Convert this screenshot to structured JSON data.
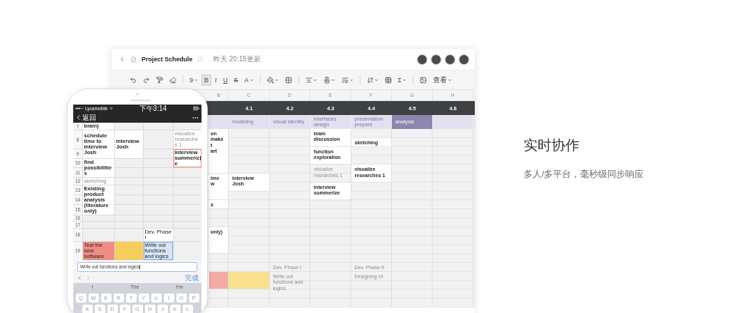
{
  "sheet_window": {
    "header": {
      "title": "Project Schedule",
      "updated": "昨天 20:15更新",
      "avatars": [
        {
          "kind": "photo"
        },
        {
          "kind": "photo"
        },
        {
          "kind": "photo"
        },
        {
          "kind": "photo"
        }
      ]
    },
    "toolbar": [
      {
        "kind": "undo"
      },
      {
        "kind": "redo"
      },
      {
        "kind": "painter"
      },
      {
        "kind": "eraser"
      },
      {
        "kind": "divider"
      },
      {
        "kind": "size",
        "text": "9",
        "dropdown": true
      },
      {
        "kind": "bold",
        "text": "B",
        "selected": true
      },
      {
        "kind": "italic",
        "text": "I",
        "selected": false
      },
      {
        "kind": "underline",
        "text": "U",
        "selected": false
      },
      {
        "kind": "strike",
        "text": "S",
        "selected": false
      },
      {
        "kind": "color",
        "text": "A",
        "dropdown": true
      },
      {
        "kind": "divider"
      },
      {
        "kind": "fill",
        "dropdown": true
      },
      {
        "kind": "merge"
      },
      {
        "kind": "divider"
      },
      {
        "kind": "align",
        "dropdown": true
      },
      {
        "kind": "valign",
        "dropdown": true
      },
      {
        "kind": "wrap",
        "dropdown": true
      },
      {
        "kind": "divider"
      },
      {
        "kind": "sort",
        "dropdown": true
      },
      {
        "kind": "table"
      },
      {
        "kind": "sum",
        "text": "Σ",
        "dropdown": true
      },
      {
        "kind": "divider"
      },
      {
        "kind": "image"
      },
      {
        "kind": "menu",
        "text": "查看",
        "dropdown": true
      }
    ],
    "columns": [
      "B",
      "C",
      "D",
      "E",
      "F",
      "G",
      "H"
    ],
    "weeks": [
      "4.1",
      "4.2",
      "4.3",
      "4.4",
      "4.5",
      "4.6"
    ],
    "phases": [
      {
        "text": "modeling",
        "selected": false
      },
      {
        "text": "visual identity",
        "selected": false
      },
      {
        "text": "interfaces design",
        "selected": false
      },
      {
        "text": "presentation prepare",
        "selected": false
      },
      {
        "text": "analysis",
        "selected": true
      },
      {
        "selected": false
      }
    ],
    "rows": [
      [
        {
          "kind": "bold",
          "text": "on\nmake\nt\nart"
        },
        {
          "kind": "empty"
        },
        {
          "kind": "empty"
        },
        {
          "kind": "bold",
          "text": "team discussion"
        },
        {
          "kind": "empty"
        },
        {
          "kind": "empty"
        },
        {
          "kind": "empty"
        }
      ],
      [
        {
          "kind": "merged"
        },
        {
          "kind": "empty"
        },
        {
          "kind": "empty"
        },
        {
          "kind": "merged"
        },
        {
          "kind": "bold",
          "text": "sketching"
        },
        {
          "kind": "empty"
        },
        {
          "kind": "empty"
        }
      ],
      [
        {
          "kind": "merged"
        },
        {
          "kind": "empty"
        },
        {
          "kind": "empty"
        },
        {
          "kind": "bold",
          "text": "function exploration"
        },
        {
          "kind": "empty"
        },
        {
          "kind": "empty"
        },
        {
          "kind": "empty"
        }
      ],
      [
        {
          "kind": "merged"
        },
        {
          "kind": "empty"
        },
        {
          "kind": "empty"
        },
        {
          "kind": "merged"
        },
        {
          "kind": "empty"
        },
        {
          "kind": "empty"
        },
        {
          "kind": "empty"
        }
      ],
      [
        {
          "kind": "merged"
        },
        {
          "kind": "empty"
        },
        {
          "kind": "empty"
        },
        {
          "kind": "faded",
          "text": "visualize researches 1"
        },
        {
          "kind": "bold",
          "text": "visualize researches 1"
        },
        {
          "kind": "empty"
        },
        {
          "kind": "empty"
        }
      ],
      [
        {
          "kind": "bold",
          "text": "ime\nw"
        },
        {
          "kind": "bold",
          "text": "interview Josh"
        },
        {
          "kind": "empty"
        },
        {
          "kind": "merged"
        },
        {
          "kind": "merged"
        },
        {
          "kind": "empty"
        },
        {
          "kind": "empty"
        }
      ],
      [
        {
          "kind": "merged"
        },
        {
          "kind": "merged"
        },
        {
          "kind": "empty"
        },
        {
          "kind": "bold",
          "text": "interview summerize"
        },
        {
          "kind": "empty"
        },
        {
          "kind": "empty"
        },
        {
          "kind": "empty"
        }
      ],
      [
        {
          "kind": "merged"
        },
        {
          "kind": "empty"
        },
        {
          "kind": "empty"
        },
        {
          "kind": "merged"
        },
        {
          "kind": "empty"
        },
        {
          "kind": "empty"
        },
        {
          "kind": "empty"
        }
      ],
      [
        {
          "kind": "bold",
          "text": "s"
        },
        {
          "kind": "empty"
        },
        {
          "kind": "empty"
        },
        {
          "kind": "empty"
        },
        {
          "kind": "empty"
        },
        {
          "kind": "empty"
        },
        {
          "kind": "empty"
        }
      ],
      [
        {
          "kind": "empty"
        },
        {
          "kind": "empty"
        },
        {
          "kind": "empty"
        },
        {
          "kind": "empty"
        },
        {
          "kind": "empty"
        },
        {
          "kind": "empty"
        },
        {
          "kind": "empty"
        }
      ],
      [
        {
          "kind": "empty"
        },
        {
          "kind": "empty"
        },
        {
          "kind": "empty"
        },
        {
          "kind": "empty"
        },
        {
          "kind": "empty"
        },
        {
          "kind": "empty"
        },
        {
          "kind": "empty"
        }
      ],
      [
        {
          "kind": "bold",
          "text": "only)"
        },
        {
          "kind": "empty"
        },
        {
          "kind": "empty"
        },
        {
          "kind": "empty"
        },
        {
          "kind": "empty"
        },
        {
          "kind": "empty"
        },
        {
          "kind": "empty"
        }
      ],
      [
        {
          "kind": "merged"
        },
        {
          "kind": "empty"
        },
        {
          "kind": "empty"
        },
        {
          "kind": "empty"
        },
        {
          "kind": "empty"
        },
        {
          "kind": "empty"
        },
        {
          "kind": "empty"
        }
      ],
      [
        {
          "kind": "merged"
        },
        {
          "kind": "empty"
        },
        {
          "kind": "empty"
        },
        {
          "kind": "empty"
        },
        {
          "kind": "empty"
        },
        {
          "kind": "empty"
        },
        {
          "kind": "empty"
        }
      ],
      [
        {
          "kind": "empty"
        },
        {
          "kind": "empty"
        },
        {
          "kind": "empty"
        },
        {
          "kind": "empty"
        },
        {
          "kind": "empty"
        },
        {
          "kind": "empty"
        },
        {
          "kind": "empty"
        }
      ],
      [
        {
          "kind": "empty"
        },
        {
          "kind": "empty"
        },
        {
          "kind": "plain",
          "text": "Dev. Phase I"
        },
        {
          "kind": "empty"
        },
        {
          "kind": "plain",
          "text": "Dev. Phase II"
        },
        {
          "kind": "empty"
        },
        {
          "kind": "empty"
        }
      ],
      [
        {
          "kind": "filled",
          "color": "#f4aaa5"
        },
        {
          "kind": "filled",
          "color": "#f9e08e"
        },
        {
          "kind": "plain",
          "text": "Write out functions and logics"
        },
        {
          "kind": "empty"
        },
        {
          "kind": "plain",
          "text": "Designing UI"
        },
        {
          "kind": "empty"
        },
        {
          "kind": "empty"
        }
      ],
      [
        {
          "kind": "merged"
        },
        {
          "kind": "merged"
        },
        {
          "kind": "merged"
        },
        {
          "kind": "empty"
        },
        {
          "kind": "merged"
        },
        {
          "kind": "empty"
        },
        {
          "kind": "empty"
        }
      ],
      [
        {
          "kind": "empty"
        },
        {
          "kind": "empty"
        },
        {
          "kind": "merged"
        },
        {
          "kind": "empty"
        },
        {
          "kind": "empty"
        },
        {
          "kind": "empty"
        },
        {
          "kind": "empty"
        }
      ],
      [
        {
          "kind": "empty"
        },
        {
          "kind": "empty"
        },
        {
          "kind": "empty"
        },
        {
          "kind": "empty"
        },
        {
          "kind": "empty"
        },
        {
          "kind": "empty"
        },
        {
          "kind": "empty"
        }
      ]
    ]
  },
  "phone": {
    "status": {
      "carrier": "Lycamobile",
      "time": "下午3:14"
    },
    "nav": {
      "back": "返回"
    },
    "rows": [
      {
        "number": "7",
        "cells": [
          {
            "kind": "bold",
            "text": "brain)"
          },
          {
            "kind": "empty"
          },
          {
            "kind": "empty"
          },
          {
            "kind": "empty"
          }
        ]
      },
      {
        "number": "8",
        "cells": [
          {
            "kind": "bold",
            "text": "schedule time to interview Josh"
          },
          {
            "kind": "bold",
            "text": "interview Josh"
          },
          {
            "kind": "empty"
          },
          {
            "kind": "faded",
            "text": "visualize researches 1"
          }
        ]
      },
      {
        "number": "9",
        "cells": [
          {
            "kind": "merged"
          },
          {
            "kind": "merged"
          },
          {
            "kind": "empty"
          },
          {
            "kind": "outlined",
            "text": "interview summerize"
          }
        ]
      },
      {
        "number": "10",
        "cells": [
          {
            "kind": "bold",
            "text": "find possibilities"
          },
          {
            "kind": "empty"
          },
          {
            "kind": "empty"
          },
          {
            "kind": "merged"
          }
        ]
      },
      {
        "number": "11",
        "cells": [
          {
            "kind": "merged"
          },
          {
            "kind": "empty"
          },
          {
            "kind": "empty"
          },
          {
            "kind": "empty"
          }
        ]
      },
      {
        "number": "12",
        "cells": [
          {
            "kind": "faded",
            "text": "sketching"
          },
          {
            "kind": "empty"
          },
          {
            "kind": "empty"
          },
          {
            "kind": "empty"
          }
        ]
      },
      {
        "number": "13",
        "cells": [
          {
            "kind": "bold",
            "text": "Existing product analysis (literature only)"
          },
          {
            "kind": "empty"
          },
          {
            "kind": "empty"
          },
          {
            "kind": "empty"
          }
        ]
      },
      {
        "number": "14",
        "cells": [
          {
            "kind": "merged"
          },
          {
            "kind": "empty"
          },
          {
            "kind": "empty"
          },
          {
            "kind": "empty"
          }
        ]
      },
      {
        "number": "15",
        "cells": [
          {
            "kind": "merged"
          },
          {
            "kind": "empty"
          },
          {
            "kind": "empty"
          },
          {
            "kind": "empty"
          }
        ]
      },
      {
        "number": "16",
        "cells": [
          {
            "kind": "empty"
          },
          {
            "kind": "empty"
          },
          {
            "kind": "empty"
          },
          {
            "kind": "empty"
          }
        ]
      },
      {
        "number": "17",
        "cells": [
          {
            "kind": "empty"
          },
          {
            "kind": "empty"
          },
          {
            "kind": "empty"
          },
          {
            "kind": "empty"
          }
        ]
      },
      {
        "number": "18",
        "cells": [
          {
            "kind": "empty"
          },
          {
            "kind": "empty"
          },
          {
            "kind": "plain",
            "text": "Dev. Phase I"
          },
          {
            "kind": "empty"
          }
        ]
      },
      {
        "number": "19",
        "cells": [
          {
            "kind": "filled",
            "color": "#ef8d84",
            "text": "Test the new software"
          },
          {
            "kind": "filled",
            "color": "#f5cd5c"
          },
          {
            "kind": "active",
            "text": "Write out functions and logics"
          },
          {
            "kind": "empty"
          }
        ]
      }
    ],
    "input": {
      "value": "Write out functions and logics"
    },
    "done": "完成",
    "suggestions": [
      "I",
      "The",
      "I'm"
    ],
    "keys": [
      [
        "Q",
        "W",
        "E",
        "R",
        "T",
        "Y",
        "U",
        "I",
        "O",
        "P"
      ],
      [
        "A",
        "S",
        "D",
        "F",
        "G",
        "H",
        "J",
        "K",
        "L"
      ]
    ]
  },
  "feature": {
    "title": "实时协作",
    "subtitle": "多人/多平台，毫秒级同步响应"
  }
}
